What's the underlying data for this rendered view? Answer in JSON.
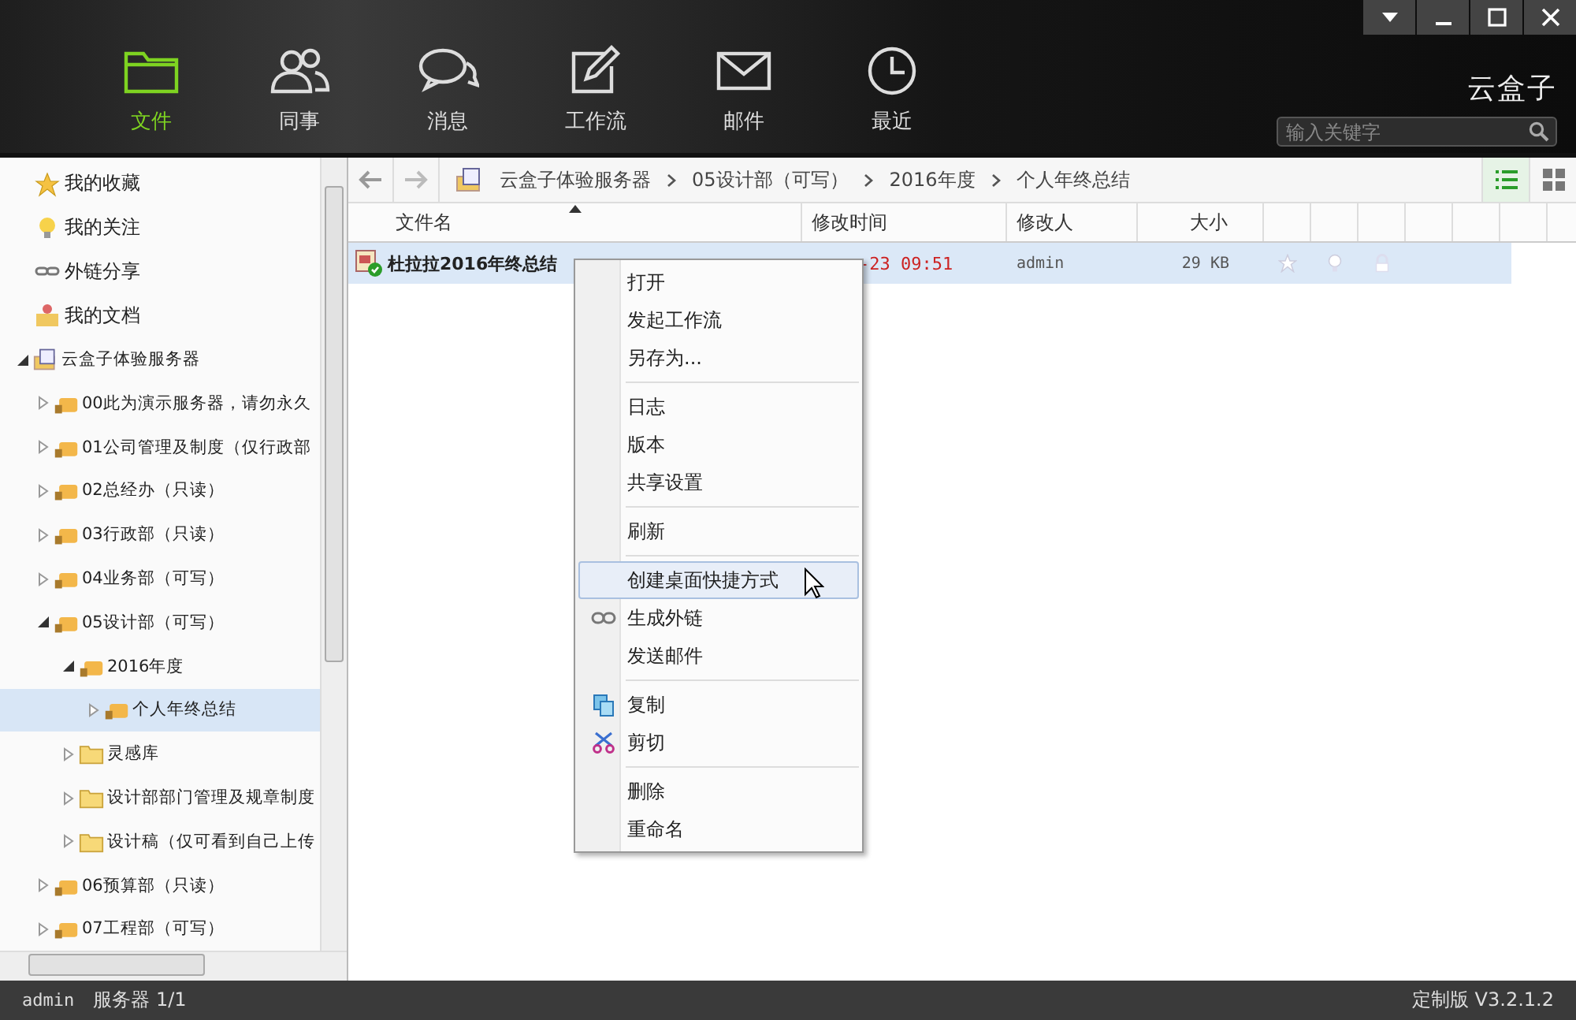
{
  "nav": [
    {
      "label": "文件",
      "kind": "folder",
      "selected": true
    },
    {
      "label": "同事",
      "kind": "people",
      "selected": false
    },
    {
      "label": "消息",
      "kind": "chat",
      "selected": false
    },
    {
      "label": "工作流",
      "kind": "edit",
      "selected": false
    },
    {
      "label": "邮件",
      "kind": "mail",
      "selected": false
    },
    {
      "label": "最近",
      "kind": "clock",
      "selected": false
    }
  ],
  "brand": "云盒子",
  "search": {
    "placeholder": "输入关键字"
  },
  "sidebar": {
    "favorites": [
      {
        "label": "我的收藏",
        "kind": "star"
      },
      {
        "label": "我的关注",
        "kind": "bulb"
      },
      {
        "label": "外链分享",
        "kind": "link"
      },
      {
        "label": "我的文档",
        "kind": "user"
      }
    ],
    "tree": [
      {
        "label": "云盒子体验服务器",
        "kind": "server",
        "expanded": true,
        "selected": false,
        "children": [
          {
            "label": "00此为演示服务器，请勿永久",
            "kind": "shared",
            "expanded": false,
            "selected": false
          },
          {
            "label": "01公司管理及制度（仅行政部",
            "kind": "shared",
            "expanded": false,
            "selected": false
          },
          {
            "label": "02总经办（只读）",
            "kind": "shared",
            "expanded": false,
            "selected": false
          },
          {
            "label": "03行政部（只读）",
            "kind": "shared",
            "expanded": false,
            "selected": false
          },
          {
            "label": "04业务部（可写）",
            "kind": "shared",
            "expanded": false,
            "selected": false
          },
          {
            "label": "05设计部（可写）",
            "kind": "shared",
            "expanded": true,
            "selected": false,
            "children": [
              {
                "label": "2016年度",
                "kind": "shared",
                "expanded": true,
                "selected": false,
                "children": [
                  {
                    "label": "个人年终总结",
                    "kind": "shared",
                    "expanded": false,
                    "selected": true
                  }
                ]
              },
              {
                "label": "灵感库",
                "kind": "folder",
                "expanded": false,
                "selected": false
              },
              {
                "label": "设计部部门管理及规章制度",
                "kind": "folder",
                "expanded": false,
                "selected": false
              },
              {
                "label": "设计稿（仅可看到自己上传",
                "kind": "folder",
                "expanded": false,
                "selected": false
              }
            ]
          },
          {
            "label": "06预算部（只读）",
            "kind": "shared",
            "expanded": false,
            "selected": false
          },
          {
            "label": "07工程部（可写）",
            "kind": "shared",
            "expanded": false,
            "selected": false
          }
        ]
      }
    ]
  },
  "breadcrumb": [
    "云盒子体验服务器",
    "05设计部（可写）",
    "2016年度",
    "个人年终总结"
  ],
  "views": [
    {
      "kind": "list",
      "selected": true
    },
    {
      "kind": "grid",
      "selected": false
    }
  ],
  "table": {
    "columns": [
      {
        "label": "文件名",
        "sorted": true
      },
      {
        "label": "修改时间",
        "sorted": false
      },
      {
        "label": "修改人",
        "sorted": false
      },
      {
        "label": "大小",
        "sorted": false
      }
    ],
    "rows": [
      {
        "name": "杜拉拉2016年终总结",
        "modified": "-23 09:51",
        "author": "admin",
        "size": "29 KB",
        "selected": true
      }
    ]
  },
  "context_menu": {
    "groups": [
      [
        {
          "label": "打开",
          "kind": "plain",
          "selected": false
        },
        {
          "label": "发起工作流",
          "kind": "plain",
          "selected": false
        },
        {
          "label": "另存为...",
          "kind": "plain",
          "selected": false
        }
      ],
      [
        {
          "label": "日志",
          "kind": "plain",
          "selected": false
        },
        {
          "label": "版本",
          "kind": "plain",
          "selected": false
        },
        {
          "label": "共享设置",
          "kind": "plain",
          "selected": false
        }
      ],
      [
        {
          "label": "刷新",
          "kind": "plain",
          "selected": false
        }
      ],
      [
        {
          "label": "创建桌面快捷方式",
          "kind": "plain",
          "selected": true
        },
        {
          "label": "生成外链",
          "kind": "link",
          "selected": false
        },
        {
          "label": "发送邮件",
          "kind": "plain",
          "selected": false
        }
      ],
      [
        {
          "label": "复制",
          "kind": "copy",
          "selected": false
        },
        {
          "label": "剪切",
          "kind": "cut",
          "selected": false
        }
      ],
      [
        {
          "label": "删除",
          "kind": "plain",
          "selected": false
        },
        {
          "label": "重命名",
          "kind": "plain",
          "selected": false
        }
      ]
    ]
  },
  "status_bar": {
    "user": "admin",
    "server": "服务器 1/1",
    "edition": "定制版 V3.2.1.2"
  }
}
